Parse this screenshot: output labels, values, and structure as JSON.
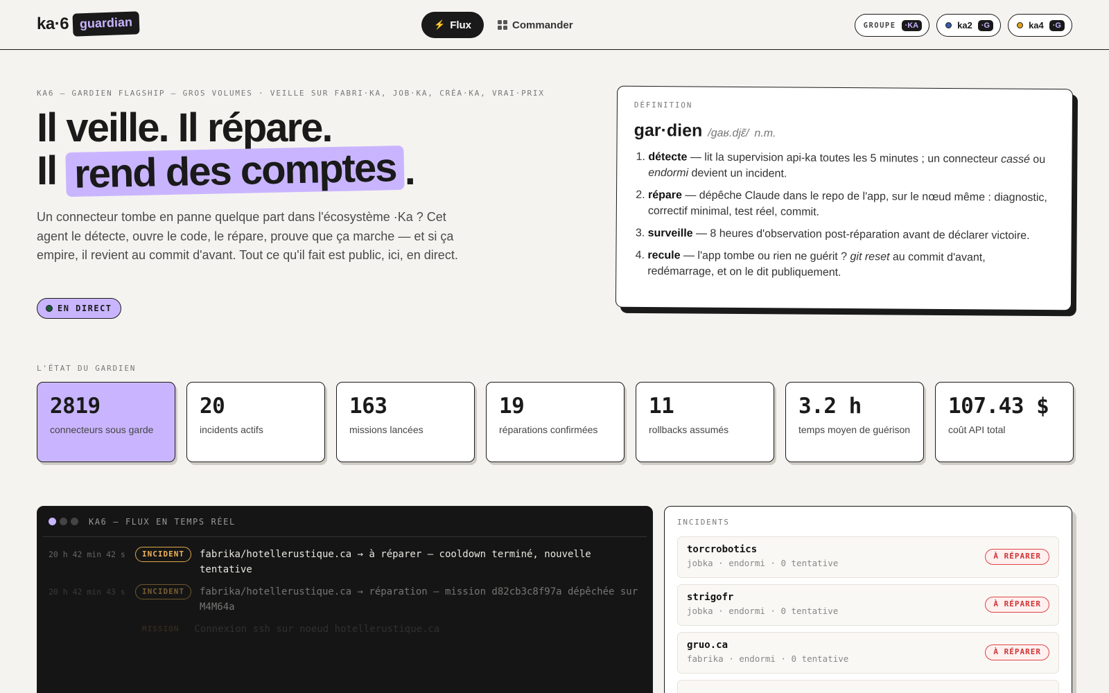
{
  "header": {
    "logo_text": "ka·6",
    "logo_badge": "guardian",
    "nav": [
      {
        "label": "Flux",
        "icon": "lightning-icon",
        "active": true
      },
      {
        "label": "Commander",
        "icon": "grid-icon",
        "active": false
      }
    ],
    "chips": [
      {
        "label": "GROUPE",
        "tag": "·KA"
      },
      {
        "label": "ka2",
        "tag": "·G",
        "dot_color": "#3a5aa8"
      },
      {
        "label": "ka4",
        "tag": "·G",
        "dot_color": "#e0a020"
      }
    ]
  },
  "hero": {
    "eyebrow": "KA6 — GARDIEN FLAGSHIP — GROS VOLUMES · VEILLE SUR FABRI·KA, JOB·KA, CRÉA·KA, VRAI·PRIX",
    "title_line1": "Il veille. Il répare.",
    "title_pre": "Il ",
    "title_highlight": "rend des comptes",
    "title_post": ".",
    "paragraph": "Un connecteur tombe en panne quelque part dans l'écosystème ·Ka ? Cet agent le détecte, ouvre le code, le répare, prouve que ça marche — et si ça empire, il revient au commit d'avant. Tout ce qu'il fait est public, ici, en direct.",
    "live_label": "EN DIRECT"
  },
  "definition": {
    "eyebrow": "DÉFINITION",
    "word": "gar·dien",
    "phonetic": "/gaʁ.djɛ̃/",
    "pos": "n.m.",
    "items": [
      {
        "term": "détecte",
        "a": " — lit la supervision api-ka toutes les 5 minutes ; un connecteur ",
        "em1": "cassé",
        "b": " ou ",
        "em2": "endormi",
        "c": " devient un incident."
      },
      {
        "term": "répare",
        "a": " — dépêche Claude dans le repo de l'app, sur le nœud même : diagnostic, correctif minimal, test réel, commit."
      },
      {
        "term": "surveille",
        "a": " — 8 heures d'observation post-réparation avant de déclarer victoire."
      },
      {
        "term": "recule",
        "a": " — l'app tombe ou rien ne guérit ? ",
        "em1": "git reset",
        "b": " au commit d'avant, redémarrage, et on le dit publiquement."
      }
    ]
  },
  "stats": {
    "label": "L'ÉTAT DU GARDIEN",
    "items": [
      {
        "value": "2819",
        "label": "connecteurs sous garde"
      },
      {
        "value": "20",
        "label": "incidents actifs"
      },
      {
        "value": "163",
        "label": "missions lancées"
      },
      {
        "value": "19",
        "label": "réparations confirmées"
      },
      {
        "value": "11",
        "label": "rollbacks assumés"
      },
      {
        "value": "3.2 h",
        "label": "temps moyen de guérison"
      },
      {
        "value": "107.43 $",
        "label": "coût API total"
      }
    ]
  },
  "feed": {
    "title": "KA6 — FLUX EN TEMPS RÉEL",
    "rows": [
      {
        "time": "20 h 42 min 42 s",
        "badge": "INCIDENT",
        "message": "fabrika/hotellerustique.ca → à réparer — cooldown terminé, nouvelle tentative"
      },
      {
        "time": "20 h 42 min 43 s",
        "badge": "INCIDENT",
        "message": "fabrika/hotellerustique.ca → réparation — mission d82cb3c8f97a dépêchée sur M4M64a"
      },
      {
        "time": "",
        "badge": "MISSION",
        "message": "Connexion ssh sur noeud hotellerustique.ca"
      }
    ]
  },
  "incidents": {
    "eyebrow": "INCIDENTS",
    "items": [
      {
        "name": "torcrobotics",
        "meta": "jobka · endormi · 0 tentative",
        "status": "À RÉPARER"
      },
      {
        "name": "strigofr",
        "meta": "jobka · endormi · 0 tentative",
        "status": "À RÉPARER"
      },
      {
        "name": "gruo.ca",
        "meta": "fabrika · endormi · 0 tentative",
        "status": "À RÉPARER"
      }
    ]
  }
}
